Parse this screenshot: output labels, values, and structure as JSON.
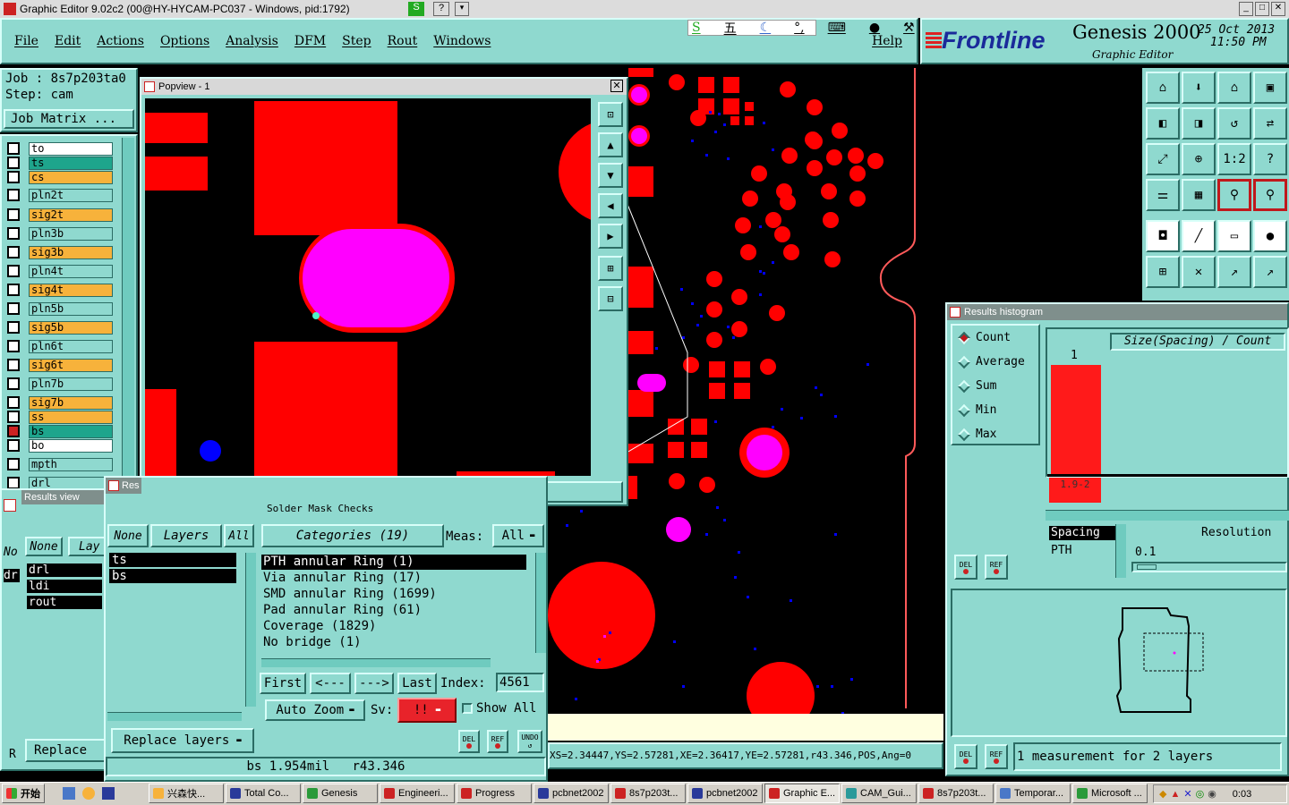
{
  "os_title": "Graphic Editor 9.02c2 (00@HY-HYCAM-PC037 - Windows, pid:1792)",
  "menu": [
    "File",
    "Edit",
    "Actions",
    "Options",
    "Analysis",
    "DFM",
    "Step",
    "Rout",
    "Windows"
  ],
  "help": "Help",
  "brand": {
    "logo": "Frontline",
    "product": "Genesis 2000",
    "sub": "Graphic Editor",
    "date": "25 Oct 2013",
    "time": "11:50 PM"
  },
  "ime": "五",
  "job": {
    "job_label": "Job : 8s7p203ta0",
    "step_label": "Step: cam",
    "matrix_btn": "Job Matrix ..."
  },
  "layers": [
    {
      "name": "to",
      "color": "#ffffff"
    },
    {
      "name": "ts",
      "color": "#1ea58c"
    },
    {
      "name": "cs",
      "color": "#f7b23b"
    },
    {
      "name": "pln2t",
      "color": "#8fd9cf"
    },
    {
      "name": "sig2t",
      "color": "#f7b23b"
    },
    {
      "name": "pln3b",
      "color": "#8fd9cf"
    },
    {
      "name": "sig3b",
      "color": "#f7b23b"
    },
    {
      "name": "pln4t",
      "color": "#8fd9cf"
    },
    {
      "name": "sig4t",
      "color": "#f7b23b"
    },
    {
      "name": "pln5b",
      "color": "#8fd9cf"
    },
    {
      "name": "sig5b",
      "color": "#f7b23b"
    },
    {
      "name": "pln6t",
      "color": "#8fd9cf"
    },
    {
      "name": "sig6t",
      "color": "#f7b23b"
    },
    {
      "name": "pln7b",
      "color": "#8fd9cf"
    },
    {
      "name": "sig7b",
      "color": "#f7b23b"
    },
    {
      "name": "ss",
      "color": "#f7b23b"
    },
    {
      "name": "bs",
      "color": "#1ea58c"
    },
    {
      "name": "bo",
      "color": "#ffffff"
    },
    {
      "name": "mpth",
      "color": "#8fd9cf"
    },
    {
      "name": "drl",
      "color": "#8fd9cf"
    }
  ],
  "popview": {
    "title": "Popview - 1",
    "close": "Close"
  },
  "results_view": {
    "title": "Results view",
    "none": "None",
    "layers_short": "Lay",
    "list": [
      "drl",
      "ldi",
      "rout"
    ],
    "replace": "Replace",
    "no_short": "No",
    "dr_short": "dr",
    "r_short": "R"
  },
  "results_main": {
    "title_short": "Res",
    "header_cut": "Solder Mask Checks",
    "none": "None",
    "layers": "Layers",
    "all": "All",
    "layer_list": [
      "ts",
      "bs"
    ],
    "categories_btn": "Categories (19)",
    "meas_label": "Meas:",
    "meas_value": "All",
    "categories": [
      "PTH annular Ring (1)",
      "Via annular Ring (17)",
      "SMD annular Ring (1699)",
      "Pad annular Ring (61)",
      "Coverage (1829)",
      "No bridge (1)"
    ],
    "first": "First",
    "prev": "<---",
    "next": "--->",
    "last": "Last",
    "index_label": "Index:",
    "index_value": "4561",
    "auto_zoom": "Auto Zoom",
    "sv_label": "Sv:",
    "sv_value": "!!",
    "show_all": "Show All",
    "replace_layers": "Replace layers",
    "del": "DEL",
    "ref": "REF",
    "undo": "UNDO",
    "status": "bs 1.954mil   r43.346",
    "status2": "PTH annular Ring"
  },
  "coord_bar": "XS=2.34447,YS=2.57281,XE=2.36417,YE=2.57281,r43.346,POS,Ang=0",
  "histogram": {
    "title": "Results histogram",
    "modes": [
      "Count",
      "Average",
      "Sum",
      "Min",
      "Max"
    ],
    "selected_mode": "Count",
    "header": "Size(Spacing) / Count",
    "bar_count": "1",
    "bar_value": 1,
    "bar_label": "1.9-2",
    "list_header": "Spacing",
    "list_item": "PTH",
    "resolution_label": "Resolution",
    "resolution_value": "0.1",
    "del": "DEL",
    "ref": "REF",
    "status": "1 measurement for 2 layers"
  },
  "taskbar": {
    "start": "开始",
    "items": [
      "兴森快...",
      "Total Co...",
      "Genesis",
      "Engineeri...",
      "Progress",
      "pcbnet2002",
      "8s7p203t...",
      "pcbnet2002",
      "Graphic E...",
      "CAM_Gui...",
      "8s7p203t...",
      "Temporar...",
      "Microsoft ..."
    ],
    "clock": "0:03"
  },
  "colors": {
    "pad": "#ff0000",
    "highlight": "#ff00ff",
    "via": "#0000ff",
    "panel": "#8fd9cf",
    "accent": "#c0181c"
  }
}
